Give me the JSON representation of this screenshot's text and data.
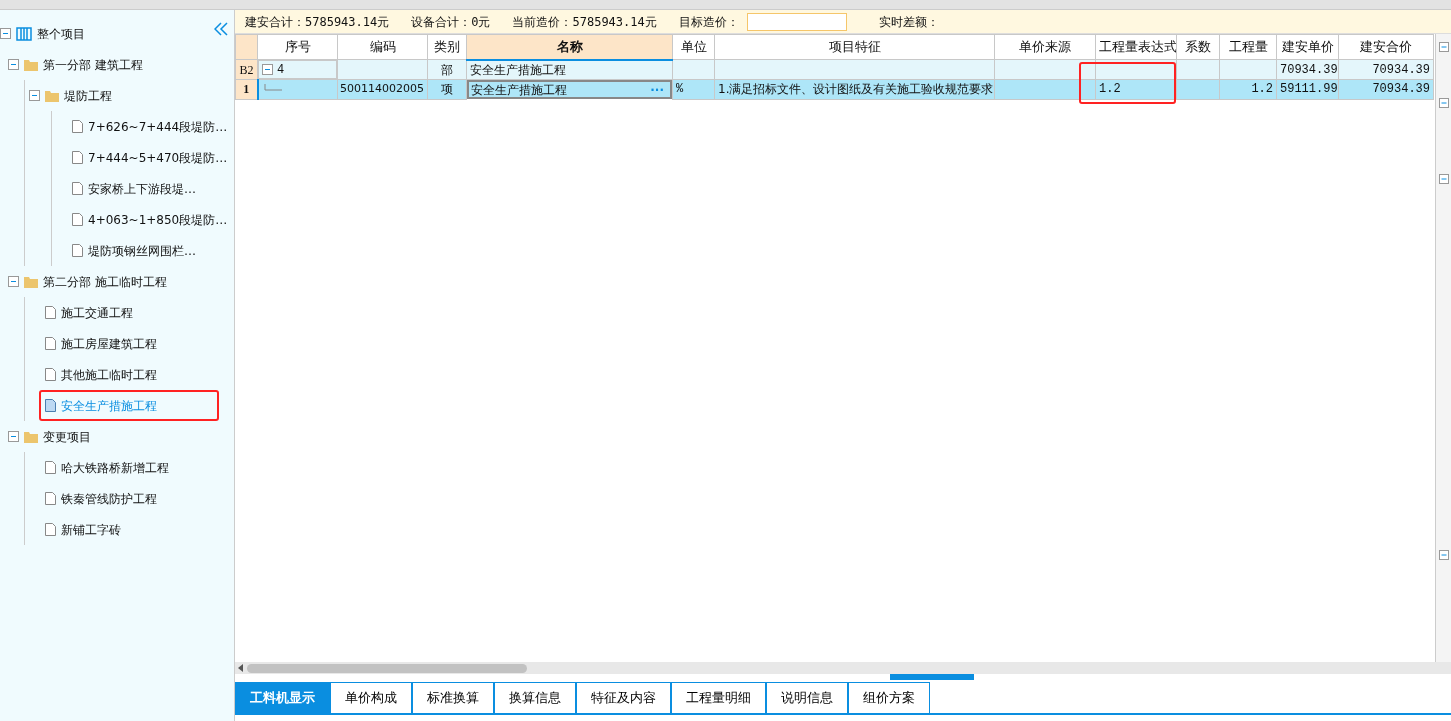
{
  "tree": {
    "label": "整个项目",
    "children": [
      {
        "label": "第一分部 建筑工程",
        "kind": "folder",
        "expanded": true,
        "selected": false,
        "children": [
          {
            "label": "堤防工程",
            "kind": "folder",
            "expanded": true,
            "selected": false,
            "children": [
              {
                "label": "7+626~7+444段堤防…",
                "kind": "file",
                "selected": false
              },
              {
                "label": "7+444~5+470段堤防…",
                "kind": "file",
                "selected": false
              },
              {
                "label": "安家桥上下游段堤…",
                "kind": "file",
                "selected": false
              },
              {
                "label": "4+063~1+850段堤防…",
                "kind": "file",
                "selected": false
              },
              {
                "label": "堤防项钢丝网围栏…",
                "kind": "file",
                "selected": false
              }
            ]
          }
        ]
      },
      {
        "label": "第二分部 施工临时工程",
        "kind": "folder",
        "expanded": true,
        "selected": false,
        "children": [
          {
            "label": "施工交通工程",
            "kind": "file",
            "selected": false
          },
          {
            "label": "施工房屋建筑工程",
            "kind": "file",
            "selected": false
          },
          {
            "label": "其他施工临时工程",
            "kind": "file",
            "selected": false
          },
          {
            "label": "安全生产措施工程",
            "kind": "file",
            "selected": true
          }
        ]
      },
      {
        "label": "变更项目",
        "kind": "folder",
        "expanded": true,
        "selected": false,
        "children": [
          {
            "label": "哈大铁路桥新增工程",
            "kind": "file",
            "selected": false
          },
          {
            "label": "铁秦管线防护工程",
            "kind": "file",
            "selected": false
          },
          {
            "label": "新铺工字砖",
            "kind": "file",
            "selected": false
          }
        ]
      }
    ]
  },
  "summary": [
    {
      "label": "建安合计：5785943.14元"
    },
    {
      "label": "设备合计：0元"
    },
    {
      "label": "当前造价：5785943.14元"
    },
    {
      "label": "目标造价：",
      "kind": "input"
    },
    {
      "label": "实时差额："
    }
  ],
  "table": {
    "columns": [
      {
        "label": "序号",
        "highlighted": false,
        "selected": false
      },
      {
        "label": "编码",
        "highlighted": false,
        "selected": false
      },
      {
        "label": "类别",
        "highlighted": false,
        "selected": false
      },
      {
        "label": "名称",
        "highlighted": false,
        "selected": true
      },
      {
        "label": "单位",
        "highlighted": false,
        "selected": false
      },
      {
        "label": "项目特征",
        "highlighted": false,
        "selected": false
      },
      {
        "label": "单价来源",
        "highlighted": false,
        "selected": false
      },
      {
        "label": "工程量表达式",
        "highlighted": true,
        "selected": false
      },
      {
        "label": "系数",
        "highlighted": false,
        "selected": false
      },
      {
        "label": "工程量",
        "highlighted": false,
        "selected": false
      },
      {
        "label": "建安单价",
        "highlighted": false,
        "selected": false
      },
      {
        "label": "建安合价",
        "highlighted": false,
        "selected": false
      }
    ],
    "rows": [
      {
        "header": "B2",
        "kind": "group",
        "expanded": true,
        "selected": false,
        "cells": [
          "4",
          "",
          "部",
          "安全生产措施工程",
          "",
          "",
          "",
          "",
          "",
          "",
          "70934.39",
          "70934.39"
        ]
      },
      {
        "header": "1",
        "kind": "item",
        "selected": true,
        "cells": [
          "",
          "500114002005",
          "项",
          "安全生产措施工程",
          "%",
          "1.满足招标文件、设计图纸及有关施工验收规范要求",
          "",
          "1.2",
          "",
          "1.2",
          "59111.99",
          "70934.39"
        ]
      }
    ]
  },
  "edit_button": {
    "label": "···"
  },
  "bottom_tabs": [
    {
      "label": "工料机显示",
      "selected": true
    },
    {
      "label": "单价构成",
      "selected": false
    },
    {
      "label": "标准换算",
      "selected": false
    },
    {
      "label": "换算信息",
      "selected": false
    },
    {
      "label": "特征及内容",
      "selected": false
    },
    {
      "label": "工程量明细",
      "selected": false
    },
    {
      "label": "说明信息",
      "selected": false
    },
    {
      "label": "组价方案",
      "selected": false
    }
  ]
}
